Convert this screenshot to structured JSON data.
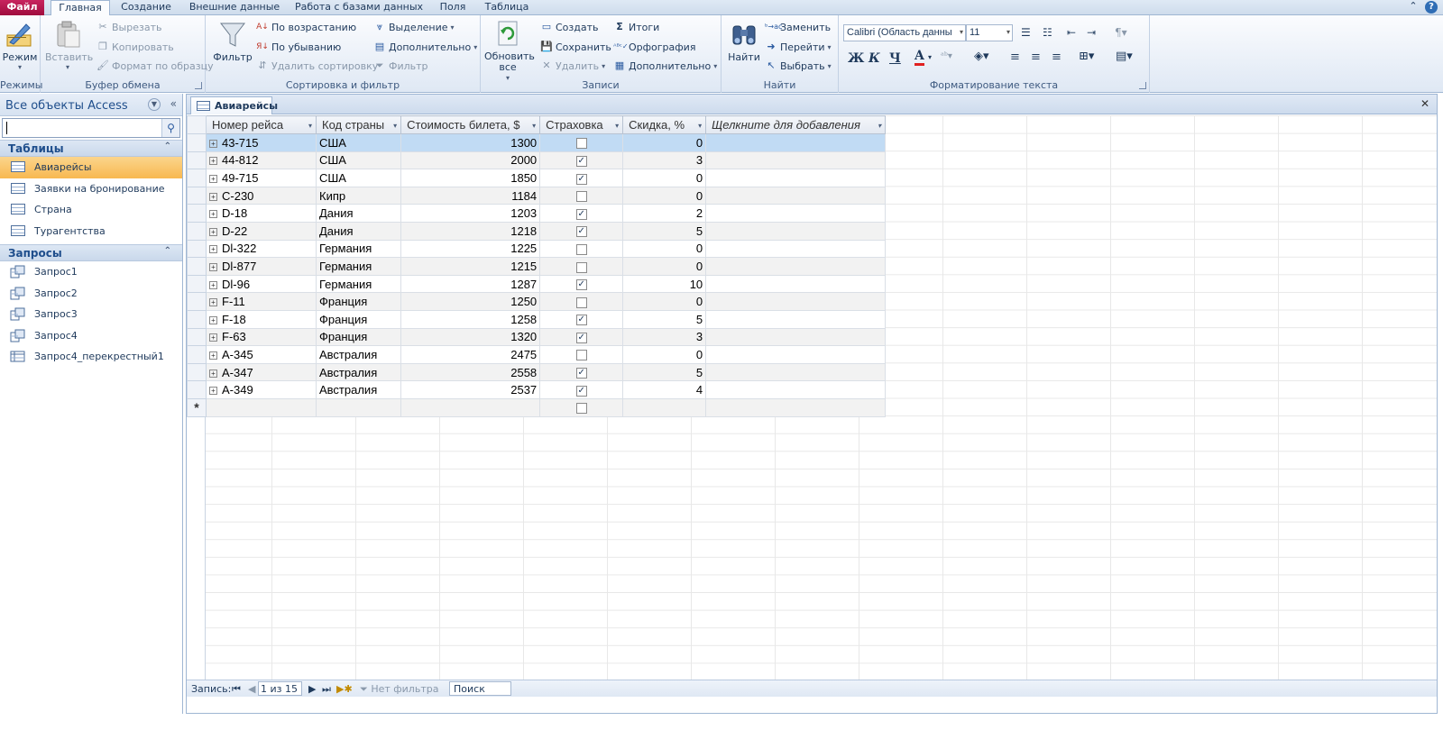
{
  "tabs": [
    {
      "label": "Файл"
    },
    {
      "label": "Главная"
    },
    {
      "label": "Создание"
    },
    {
      "label": "Внешние данные"
    },
    {
      "label": "Работа с базами данных"
    },
    {
      "label": "Поля"
    },
    {
      "label": "Таблица"
    }
  ],
  "ribbon": {
    "views": {
      "mode": "Режим",
      "group": "Режимы"
    },
    "clipboard": {
      "paste": "Вставить",
      "cut": "Вырезать",
      "copy": "Копировать",
      "format_painter": "Формат по образцу",
      "group": "Буфер обмена"
    },
    "sort_filter": {
      "filter": "Фильтр",
      "ascending": "По возрастанию",
      "descending": "По убыванию",
      "remove_sort": "Удалить сортировку",
      "selection": "Выделение",
      "advanced": "Дополнительно",
      "toggle_filter": "Фильтр",
      "group": "Сортировка и фильтр"
    },
    "records": {
      "refresh": "Обновить все",
      "new": "Создать",
      "save": "Сохранить",
      "delete": "Удалить",
      "totals": "Итоги",
      "spelling": "Орфография",
      "more": "Дополнительно",
      "group": "Записи"
    },
    "find": {
      "find": "Найти",
      "replace": "Заменить",
      "goto": "Перейти",
      "select": "Выбрать",
      "group": "Найти"
    },
    "text_format": {
      "font": "Calibri (Область данны",
      "size": "11",
      "bold": "Ж",
      "italic": "К",
      "underline": "Ч",
      "group": "Форматирование текста"
    }
  },
  "nav": {
    "title": "Все объекты Access",
    "sections": [
      {
        "title": "Таблицы",
        "items": [
          "Авиарейсы",
          "Заявки на бронирование",
          "Страна",
          "Турагентства"
        ]
      },
      {
        "title": "Запросы",
        "items": [
          "Запрос1",
          "Запрос2",
          "Запрос3",
          "Запрос4",
          "Запрос4_перекрестный1"
        ]
      }
    ]
  },
  "document": {
    "tab_title": "Авиарейсы",
    "columns": [
      "Номер рейса",
      "Код страны",
      "Стоимость билета, $",
      "Страховка",
      "Скидка, %",
      "Щелкните для добавления"
    ],
    "rows": [
      [
        "43-715",
        "США",
        "1300",
        false,
        "0"
      ],
      [
        "44-812",
        "США",
        "2000",
        true,
        "3"
      ],
      [
        "49-715",
        "США",
        "1850",
        true,
        "0"
      ],
      [
        "C-230",
        "Кипр",
        "1184",
        false,
        "0"
      ],
      [
        "D-18",
        "Дания",
        "1203",
        true,
        "2"
      ],
      [
        "D-22",
        "Дания",
        "1218",
        true,
        "5"
      ],
      [
        "Dl-322",
        "Германия",
        "1225",
        false,
        "0"
      ],
      [
        "Dl-877",
        "Германия",
        "1215",
        false,
        "0"
      ],
      [
        "Dl-96",
        "Германия",
        "1287",
        true,
        "10"
      ],
      [
        "F-11",
        "Франция",
        "1250",
        false,
        "0"
      ],
      [
        "F-18",
        "Франция",
        "1258",
        true,
        "5"
      ],
      [
        "F-63",
        "Франция",
        "1320",
        true,
        "3"
      ],
      [
        "A-345",
        "Австралия",
        "2475",
        false,
        "0"
      ],
      [
        "A-347",
        "Австралия",
        "2558",
        true,
        "5"
      ],
      [
        "A-349",
        "Австралия",
        "2537",
        true,
        "4"
      ]
    ],
    "new_row_marker": "*"
  },
  "record_bar": {
    "label": "Запись:",
    "position": "1 из 15",
    "filter": "Нет фильтра",
    "search": "Поиск"
  }
}
